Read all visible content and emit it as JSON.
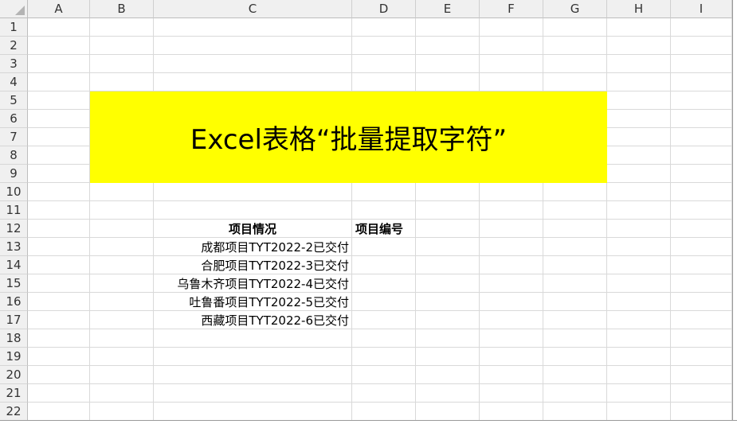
{
  "columns": [
    "A",
    "B",
    "C",
    "D",
    "E",
    "F",
    "G",
    "H",
    "I"
  ],
  "rows": [
    "1",
    "2",
    "3",
    "4",
    "5",
    "6",
    "7",
    "8",
    "9",
    "10",
    "11",
    "12",
    "13",
    "14",
    "15",
    "16",
    "17",
    "18",
    "19",
    "20",
    "21",
    "22"
  ],
  "banner": {
    "text": "Excel表格“批量提取字符”",
    "fill_color": "#FFFF00"
  },
  "table": {
    "header_c": "项目情况",
    "header_d": "项目编号",
    "items": [
      "成都项目TYT2022-2已交付",
      "合肥项目TYT2022-3已交付",
      "乌鲁木齐项目TYT2022-4已交付",
      "吐鲁番项目TYT2022-5已交付",
      "西藏项目TYT2022-6已交付"
    ]
  }
}
